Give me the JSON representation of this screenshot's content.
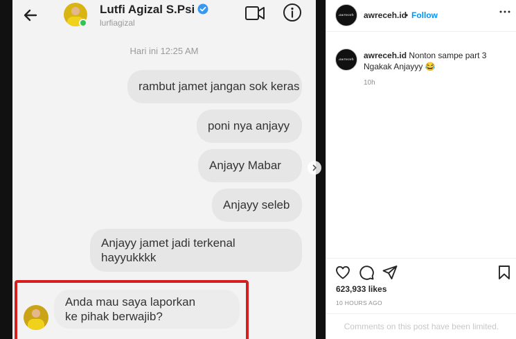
{
  "chat": {
    "contact_name": "Lutfi Agizal S.Psi",
    "contact_username": "lurfiagizal",
    "timestamp": "Hari ini 12:25 AM",
    "messages": [
      {
        "text": "rambut jamet jangan sok keras",
        "side": "right"
      },
      {
        "text": "poni nya anjayy",
        "side": "right"
      },
      {
        "text": "Anjayy Mabar",
        "side": "right"
      },
      {
        "text": "Anjayy seleb",
        "side": "right"
      },
      {
        "line1": "Anjayy jamet jadi terkenal",
        "line2": "hayyukkkk",
        "side": "right"
      },
      {
        "line1": "Anda mau saya laporkan",
        "line2": "ke pihak berwajib?",
        "side": "left"
      }
    ],
    "highlight_color": "#d41f1f"
  },
  "post": {
    "username": "awreceh.id",
    "dot": "•",
    "follow_label": "Follow",
    "logo_text": "awreceh",
    "caption_user": "awreceh.id",
    "caption_text": " Nonton sampe part 3 Ngakak Anjayyy 😂",
    "caption_time": "10h",
    "likes": "623,933 likes",
    "age": "10 HOURS AGO",
    "comments_limited": "Comments on this post have been limited.",
    "accent_color": "#0095f6"
  },
  "icons": {
    "back": "arrow-left-icon",
    "verified": "verified-badge-icon",
    "video": "video-call-icon",
    "info": "info-icon",
    "next": "chevron-right-icon",
    "more": "more-horizontal-icon",
    "like": "heart-icon",
    "comment": "comment-icon",
    "share": "paper-plane-icon",
    "save": "bookmark-icon"
  }
}
